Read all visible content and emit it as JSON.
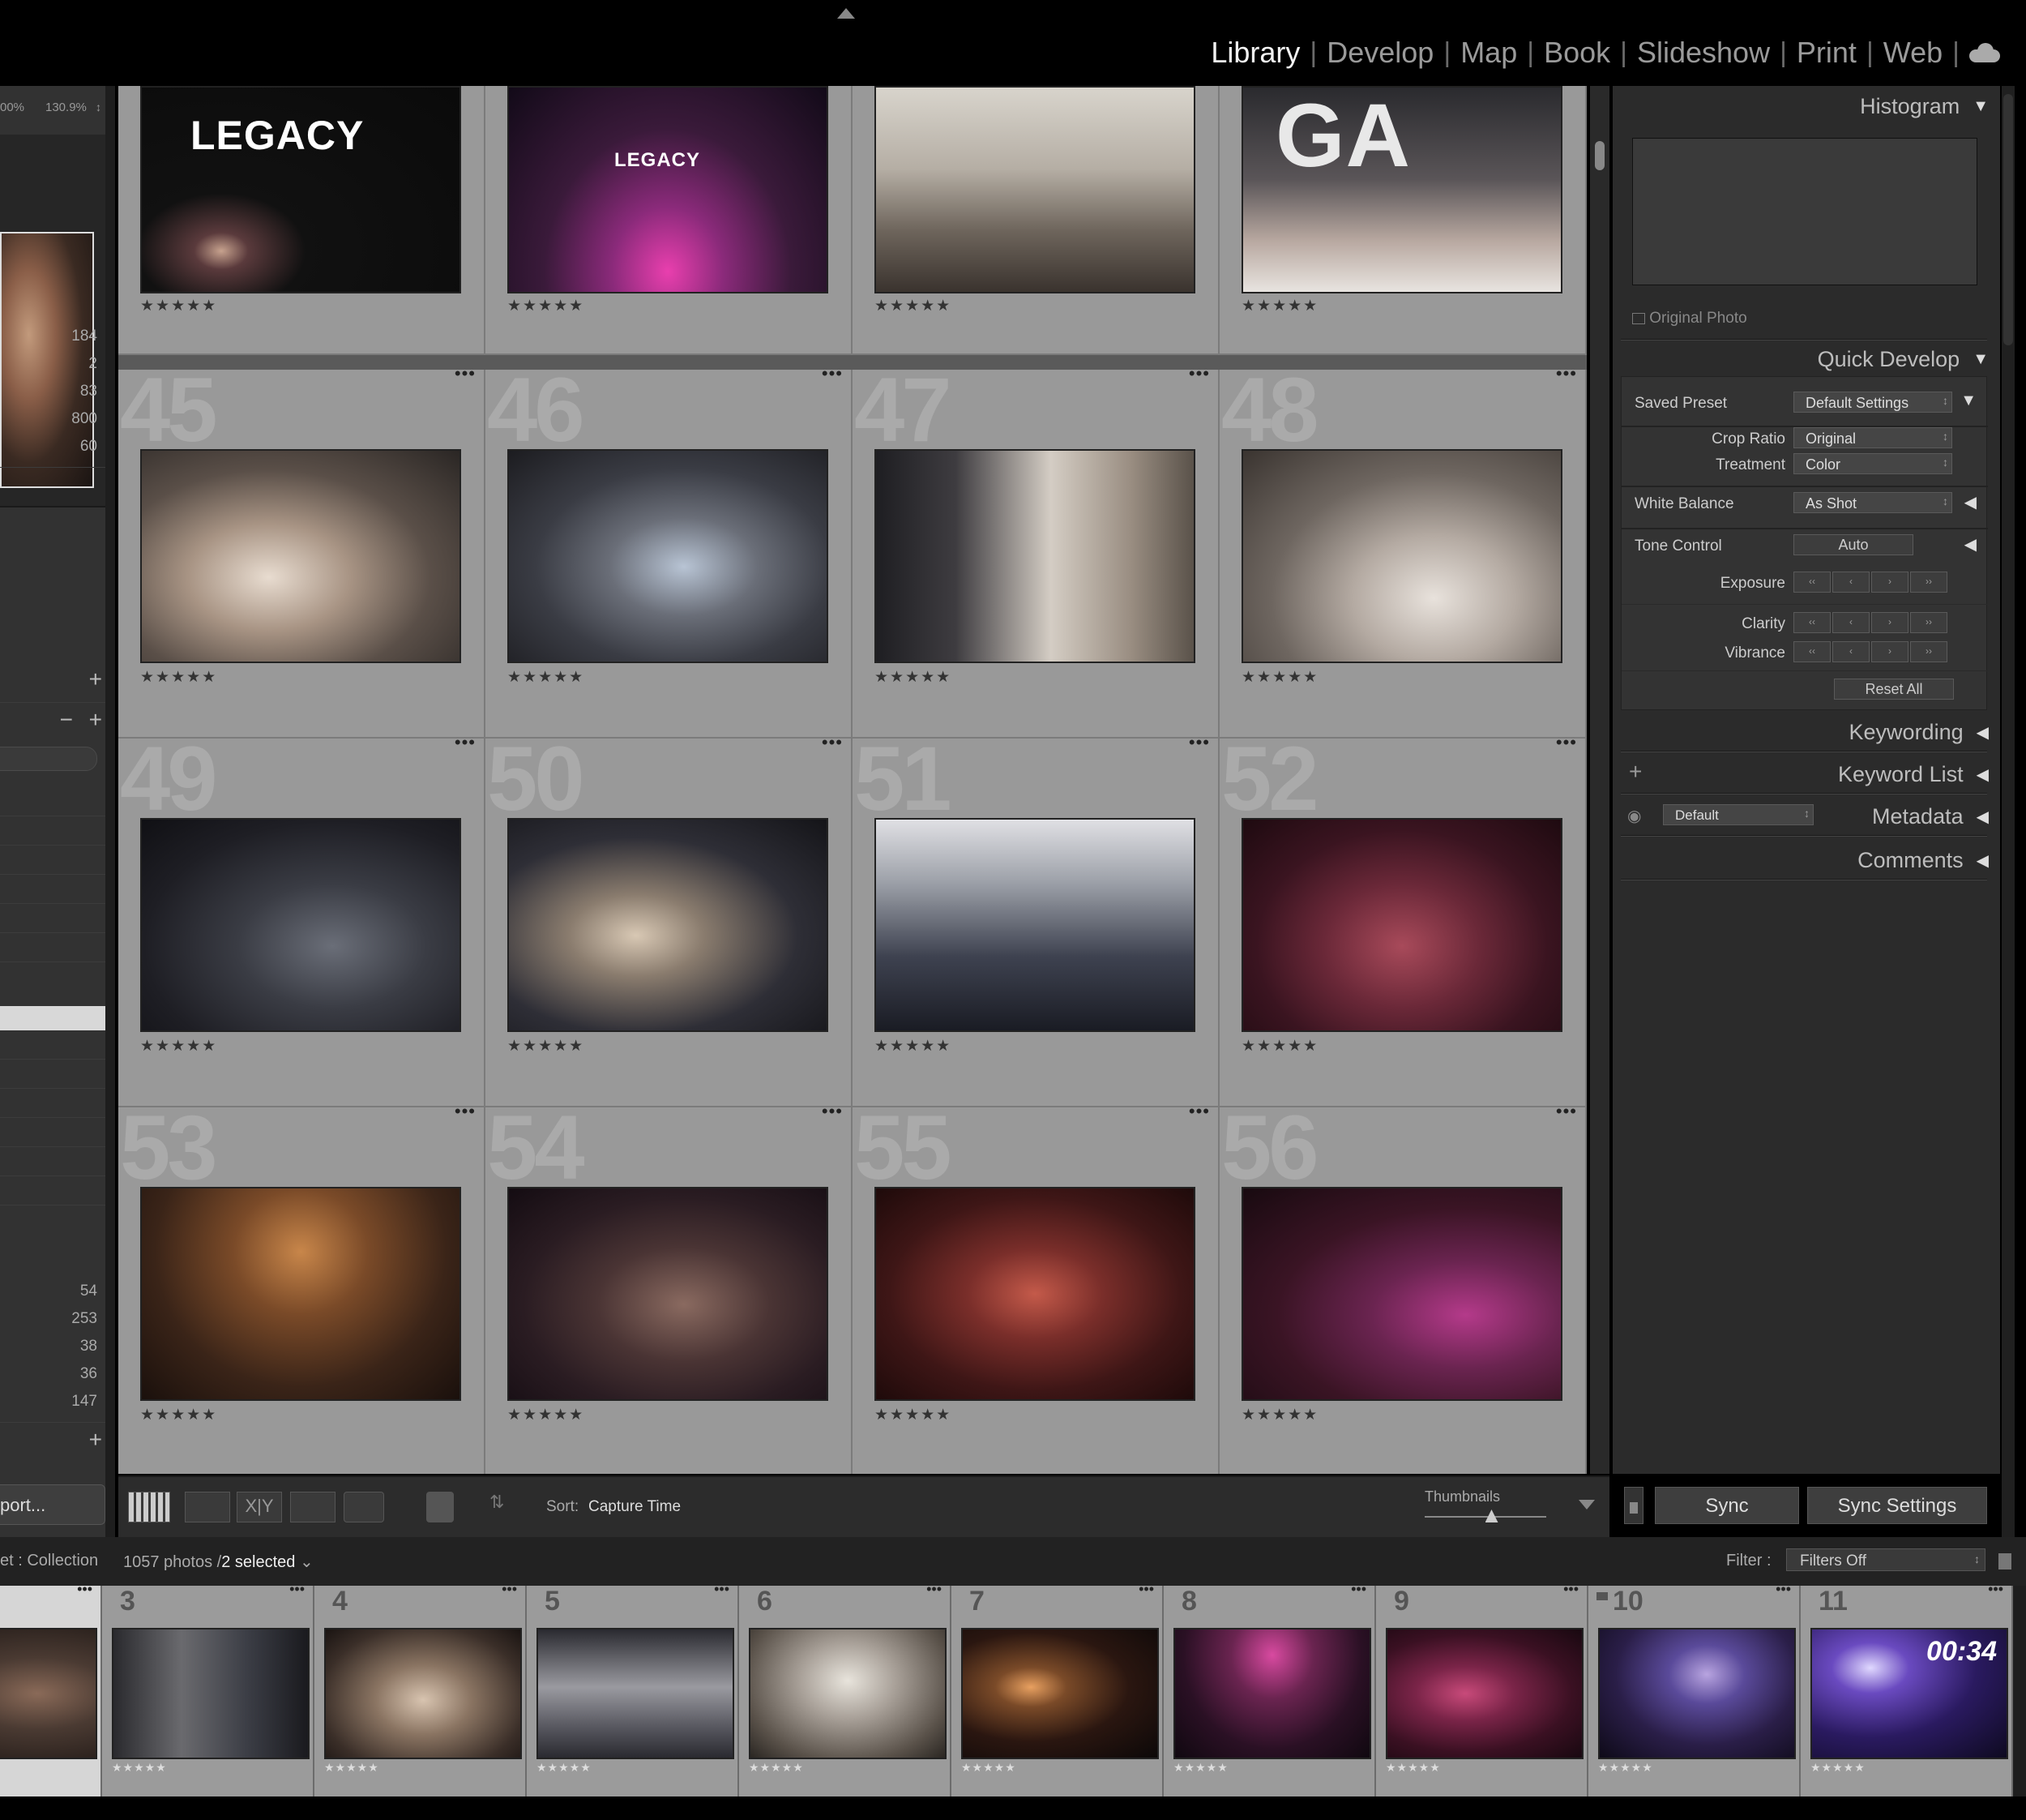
{
  "modules": [
    {
      "label": "Library",
      "active": true
    },
    {
      "label": "Develop",
      "active": false
    },
    {
      "label": "Map",
      "active": false
    },
    {
      "label": "Book",
      "active": false
    },
    {
      "label": "Slideshow",
      "active": false
    },
    {
      "label": "Print",
      "active": false
    },
    {
      "label": "Web",
      "active": false
    }
  ],
  "navigator": {
    "zoom_a": "00%",
    "zoom_b": "130.9%"
  },
  "left_counts_a": [
    "184",
    "2",
    "83",
    "800",
    "60"
  ],
  "left_counts_b": [
    "54",
    "253",
    "38",
    "36",
    "147"
  ],
  "left_import_label": "port...",
  "grid": {
    "top_row": [
      {
        "stars": "★★★★★",
        "logo": "LEGACY"
      },
      {
        "stars": "★★★★★",
        "logo": "LEGACY"
      },
      {
        "stars": "★★★★★",
        "logo": ""
      },
      {
        "stars": "★★★★★",
        "logo": "GA"
      }
    ],
    "rows": [
      [
        {
          "index": "45"
        },
        {
          "index": "46"
        },
        {
          "index": "47"
        },
        {
          "index": "48"
        }
      ],
      [
        {
          "index": "49"
        },
        {
          "index": "50"
        },
        {
          "index": "51"
        },
        {
          "index": "52"
        }
      ],
      [
        {
          "index": "53"
        },
        {
          "index": "54"
        },
        {
          "index": "55"
        },
        {
          "index": "56"
        }
      ]
    ],
    "stars": "★★★★★",
    "dots": "•••"
  },
  "toolbar": {
    "sort_label": "Sort:",
    "sort_value": "Capture Time",
    "thumbnails_label": "Thumbnails",
    "thumbnail_size": 0.55
  },
  "right_panel": {
    "histogram": "Histogram",
    "original_photo": "Original Photo",
    "quick_develop": "Quick Develop",
    "saved_preset_label": "Saved Preset",
    "saved_preset_value": "Default Settings",
    "crop_ratio_label": "Crop Ratio",
    "crop_ratio_value": "Original",
    "treatment_label": "Treatment",
    "treatment_value": "Color",
    "white_balance_label": "White Balance",
    "white_balance_value": "As Shot",
    "tone_control_label": "Tone Control",
    "tone_control_value": "Auto",
    "exposure_label": "Exposure",
    "clarity_label": "Clarity",
    "vibrance_label": "Vibrance",
    "reset_all": "Reset All",
    "keywording": "Keywording",
    "keyword_list": "Keyword List",
    "metadata_preset": "Default",
    "metadata": "Metadata",
    "comments": "Comments",
    "sync": "Sync",
    "sync_settings": "Sync Settings"
  },
  "filmstrip_header": {
    "source": "et : Collection",
    "count": "1057 photos /",
    "selected": "2 selected",
    "filter_label": "Filter :",
    "filter_value": "Filters Off"
  },
  "filmstrip": [
    {
      "index": ""
    },
    {
      "index": "3"
    },
    {
      "index": "4"
    },
    {
      "index": "5"
    },
    {
      "index": "6"
    },
    {
      "index": "7"
    },
    {
      "index": "8"
    },
    {
      "index": "9"
    },
    {
      "index": "10"
    },
    {
      "index": "11"
    }
  ],
  "filmstrip_clock": "00:34",
  "filmstrip_stars": "★★★★★",
  "colors": {
    "grid_cell": "#999999",
    "panel": "#2b2b2b",
    "active_module": "#f2f2f2"
  }
}
